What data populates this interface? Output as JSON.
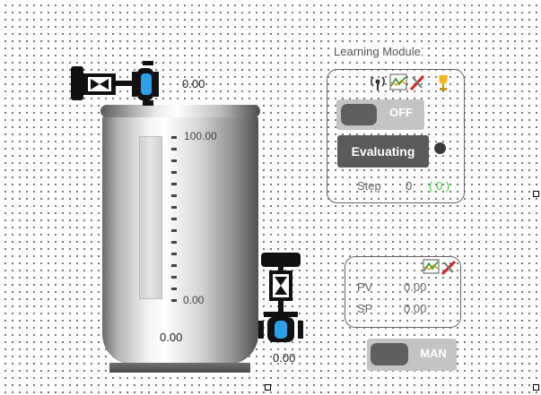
{
  "tank": {
    "level_value": "0.00",
    "scale_max": "100.00",
    "scale_min": "0.00",
    "level_fraction": 0.0
  },
  "inlet_valve": {
    "value": "0.00",
    "icon": "control-valve-icon"
  },
  "outlet_valve": {
    "value": "0.00",
    "icon": "control-valve-icon"
  },
  "learning_module": {
    "title": "Learning Module",
    "icons": [
      "signal-icon",
      "trend-icon",
      "tuning-icon",
      "trophy-icon"
    ],
    "toggle_label": "OFF",
    "evaluate_label": "Evaluating",
    "step_label": "Step",
    "step_value": "0",
    "step_count": "( 0 )"
  },
  "controller": {
    "icons": [
      "trend-icon",
      "tuning-icon"
    ],
    "pv_label": "PV",
    "pv_value": "0.00",
    "sp_label": "SP",
    "sp_value": "0.00",
    "mode_label": "MAN"
  },
  "colors": {
    "accent_blue": "#2aa0e6",
    "step_count_green": "#3cd23c"
  }
}
